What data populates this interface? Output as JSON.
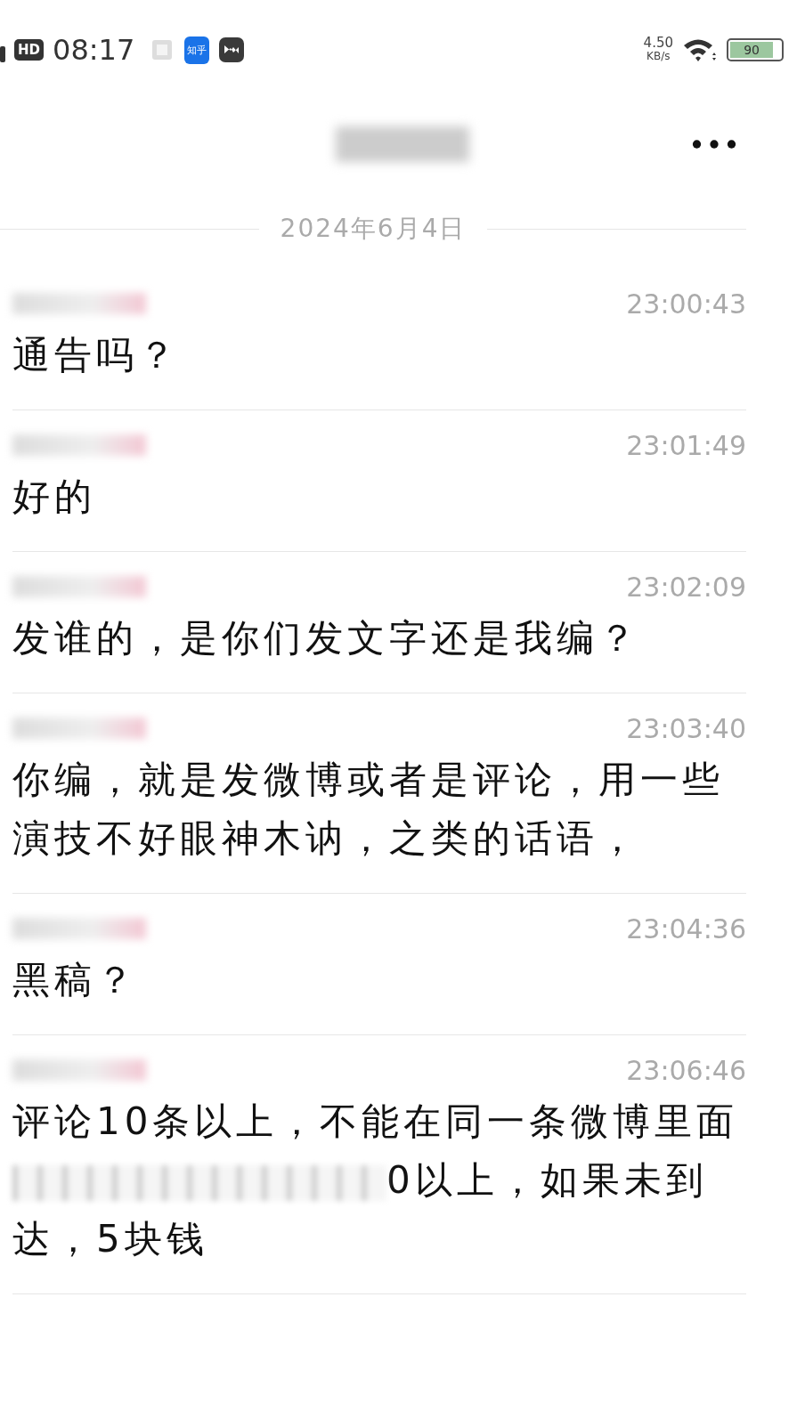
{
  "status_bar": {
    "hd_badge": "HD",
    "time": "08:17",
    "app_badge": "知乎",
    "speed": "4.50",
    "speed_unit": "KB/s",
    "battery": "90"
  },
  "date_divider": "2024年6月4日",
  "messages": [
    {
      "time": "23:00:43",
      "segments": [
        {
          "kind": "text",
          "text": "通告吗？"
        }
      ]
    },
    {
      "time": "23:01:49",
      "segments": [
        {
          "kind": "text",
          "text": "好的"
        }
      ]
    },
    {
      "time": "23:02:09",
      "segments": [
        {
          "kind": "text",
          "text": "发谁的，是你们发文字还是我编？"
        }
      ]
    },
    {
      "time": "23:03:40",
      "segments": [
        {
          "kind": "text",
          "text": "你编，就是发微博或者是评论，用一些演技不好眼神木讷，之类的话语，"
        }
      ]
    },
    {
      "time": "23:04:36",
      "segments": [
        {
          "kind": "text",
          "text": "黑稿？"
        }
      ]
    },
    {
      "time": "23:06:46",
      "segments": [
        {
          "kind": "text",
          "text": "评论10条以上，不能在同一条微博里面"
        },
        {
          "kind": "redacted"
        },
        {
          "kind": "text",
          "text": "0以上，如果未到达，5块钱"
        }
      ]
    }
  ]
}
